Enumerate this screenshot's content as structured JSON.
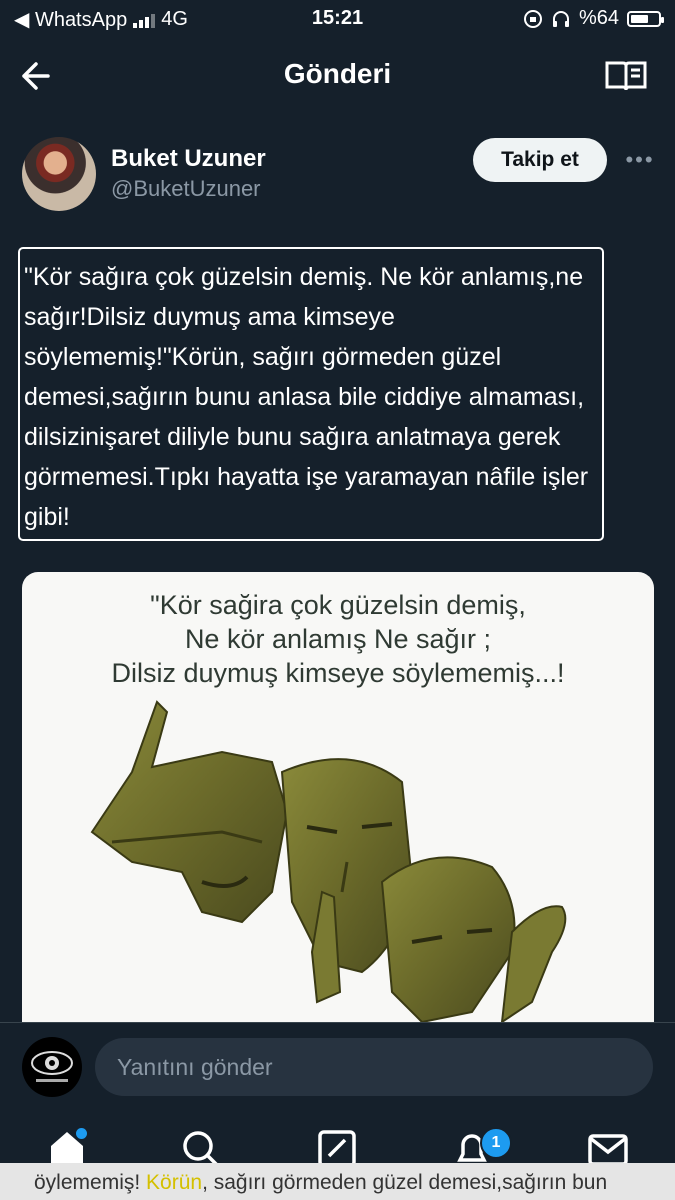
{
  "status_bar": {
    "back_app": "◀ WhatsApp",
    "network": "4G",
    "time": "15:21",
    "battery_text": "%64",
    "battery_level": 0.64
  },
  "header": {
    "title": "Gönderi"
  },
  "author": {
    "name": "Buket Uzuner",
    "handle": "@BuketUzuner",
    "follow_label": "Takip et",
    "more": "•••"
  },
  "tweet": {
    "text": "\"Kör sağıra çok güzelsin demiş. Ne kör anlamış,ne sağır!Dilsiz duymuş ama kimseye söylememiş!\"Körün, sağırı görmeden güzel demesi,sağırın bunu anlasa bile ciddiye almaması, dilsizinişaret diliyle bunu sağıra anlatmaya gerek görmemesi.Tıpkı hayatta işe yaramayan nâfile işler gibi!"
  },
  "media": {
    "caption_lines": [
      "\"Kör sağira çok güzelsin demiş,",
      "Ne kör anlamış Ne sağır ;",
      "Dilsiz duymuş kimseye söylememiş...!"
    ]
  },
  "reply": {
    "placeholder": "Yanıtını gönder"
  },
  "nav": {
    "notification_count": "1"
  },
  "overlay": {
    "before": "öylememiş! ",
    "highlight": "Körün",
    "after": ", sağırı görmeden güzel demesi,sağırın bun"
  },
  "colors": {
    "background": "#15202b",
    "accent": "#1d9bf0",
    "follow_bg": "#eff3f4"
  }
}
